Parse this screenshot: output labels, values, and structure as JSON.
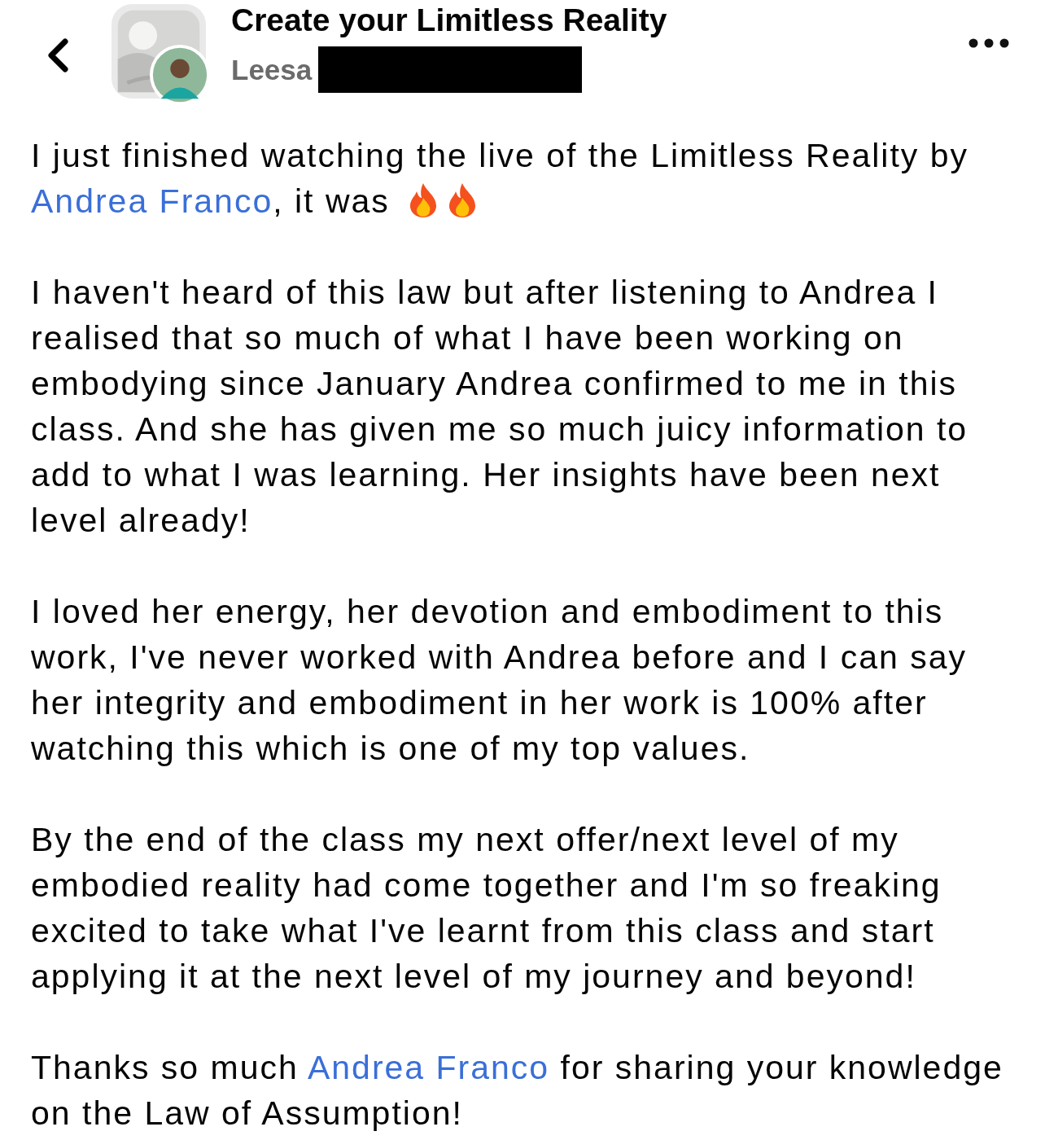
{
  "header": {
    "title": "Create your Limitless Reality",
    "author": "Leesa"
  },
  "paragraphs": [
    [
      {
        "kind": "text",
        "text": "I just finished watching the live of the Limitless Reality by "
      },
      {
        "kind": "link",
        "text": "Andrea Franco"
      },
      {
        "kind": "text",
        "text": ", it was "
      },
      {
        "kind": "icon"
      },
      {
        "kind": "icon"
      }
    ],
    [
      {
        "kind": "text",
        "text": "I haven't heard of this law but after listening to Andrea I realised that so much of what I have been working on embodying since January Andrea confirmed to me in this class. And she has given me so much juicy information to add to what I was learning. Her insights have been next level already!"
      }
    ],
    [
      {
        "kind": "text",
        "text": "I loved her energy, her devotion and embodiment to this work, I've never worked with Andrea before and I can say her integrity and embodiment in her work is 100% after watching this which is one of my top values."
      }
    ],
    [
      {
        "kind": "text",
        "text": "By the end of the class my next offer/next level of my embodied reality had come together and I'm so freaking excited to take what I've learnt from this class and start applying it at the next level of my journey and beyond!"
      }
    ],
    [
      {
        "kind": "text",
        "text": "Thanks so much "
      },
      {
        "kind": "link",
        "text": "Andrea Franco"
      },
      {
        "kind": "text",
        "text": " for sharing your knowledge on the Law of Assumption!"
      }
    ]
  ]
}
